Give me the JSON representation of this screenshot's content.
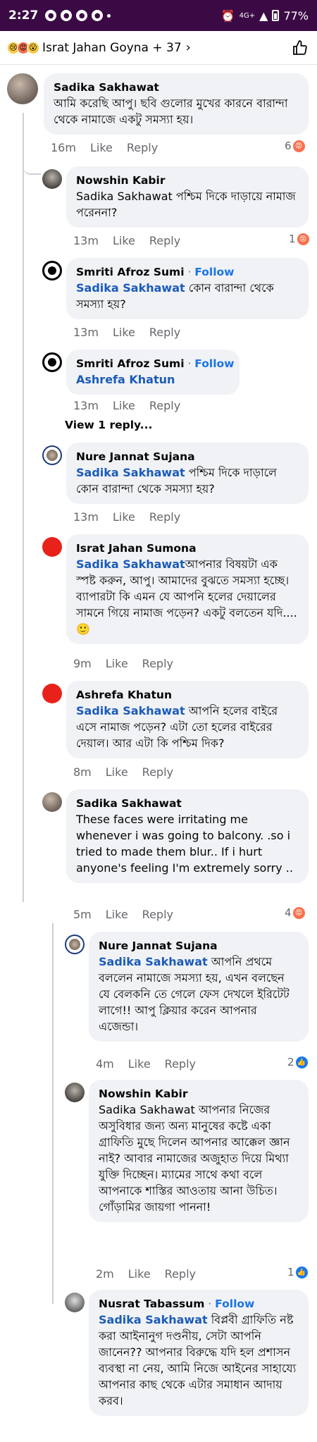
{
  "status": {
    "time": "2:27",
    "network": "4G+",
    "battery": "77%"
  },
  "header": {
    "title": "Israt Jahan Goyna + 37",
    "chevron": "›"
  },
  "comments": [
    {
      "name": "Sadika Sakhawat",
      "text": "আমি করেছি আপু। ছবি গুলোর মুখের কারনে বারান্দা থেকে নামাজে একটু সমস্যা হয়।",
      "time": "16m",
      "like": "Like",
      "reply": "Reply",
      "count": "6"
    },
    {
      "name": "Nowshin Kabir",
      "text": "Sadika Sakhawat পশ্চিম দিকে দাড়ায়ে নামাজ পরেননা?",
      "time": "13m",
      "like": "Like",
      "reply": "Reply",
      "count": "1"
    },
    {
      "name": "Smriti Afroz Sumi",
      "sep": " · ",
      "follow": "Follow",
      "mention": "Sadika Sakhawat",
      "text": " কোন বারান্দা থেকে সমস্যা হয়?",
      "time": "13m",
      "like": "Like",
      "reply": "Reply"
    },
    {
      "name": "Smriti Afroz Sumi",
      "sep": " · ",
      "follow": "Follow",
      "mention": "Ashrefa Khatun",
      "time": "13m",
      "like": "Like",
      "reply": "Reply",
      "view_replies": "View 1 reply..."
    },
    {
      "name": "Nure Jannat Sujana",
      "mention": "Sadika Sakhawat",
      "text": " পশ্চিম দিকে দাড়ালে কোন বারান্দা থেকে সমস্যা হয়?",
      "time": "13m",
      "like": "Like",
      "reply": "Reply"
    },
    {
      "name": "Israt Jahan Sumona",
      "mention": "Sadika Sakhawat",
      "text": "আপনার বিষয়টা এক স্পষ্ট করুন, আপু। আমাদের বুঝতে সমস্যা হচ্ছে। ব্যাপারটা কি এমন যে আপনি হলের দেয়ালের সামনে গিয়ে নামাজ পড়েন? একটু বলতেন যদি.... 🙂",
      "time": "9m",
      "like": "Like",
      "reply": "Reply"
    },
    {
      "name": "Ashrefa Khatun",
      "mention": "Sadika Sakhawat",
      "text": " আপনি হলের বাইরে এসে নামাজ পড়েন? এটা তো হলের বাইরের দেয়াল। আর এটা কি পশ্চিম দিক?",
      "time": "8m",
      "like": "Like",
      "reply": "Reply"
    },
    {
      "name": "Sadika Sakhawat",
      "text": "These faces were irritating me whenever i was going to balcony. .so i tried to made them blur.. If i hurt anyone's feeling I'm extremely sorry ..",
      "time": "5m",
      "like": "Like",
      "reply": "Reply",
      "count": "4"
    },
    {
      "name": "Nure Jannat Sujana",
      "mention": "Sadika Sakhawat",
      "text": " আপনি প্রথমে বললেন নামাজে সমস্যা হয়, এখন বলছেন যে বেলকনি তে গেলে ফেস দেখলে ইরিটেট লাগে!! আপু ক্লিয়ার করেন আপনার এজেন্ডা।",
      "time": "4m",
      "like": "Like",
      "reply": "Reply",
      "count": "2"
    },
    {
      "name": "Nowshin Kabir",
      "text": "Sadika Sakhawat আপনার নিজের অসুবিধার জন্য অন্য মানুষের কষ্টে একা গ্রাফিতি মুছে দিলেন আপনার আক্কেল জ্ঞান নাই? আবার নামাজের অজুহাত দিয়ে মিথ্যা যুক্তি দিচ্ছেন। ম্যামের সাথে কথা বলে আপনাকে শাস্তির আওতায় আনা উচিত। গোঁড়ামির জায়গা পাননা!",
      "time": "2m",
      "like": "Like",
      "reply": "Reply",
      "count": "1"
    },
    {
      "name": "Nusrat Tabassum",
      "sep": " · ",
      "follow": "Follow",
      "mention": "Sadika Sakhawat",
      "text": " বিপ্লবী গ্রাফিতি নষ্ট করা আইনানুগ দণ্ডনীয়, সেটা আপনি জানেন?? আপনার বিরুদ্ধে যদি হল প্রশাসন ব্যবস্থা না নেয়, আমি নিজে আইনের সাহায্যে আপনার কাছ থেকে এটার সমাধান আদায় করব।"
    }
  ]
}
